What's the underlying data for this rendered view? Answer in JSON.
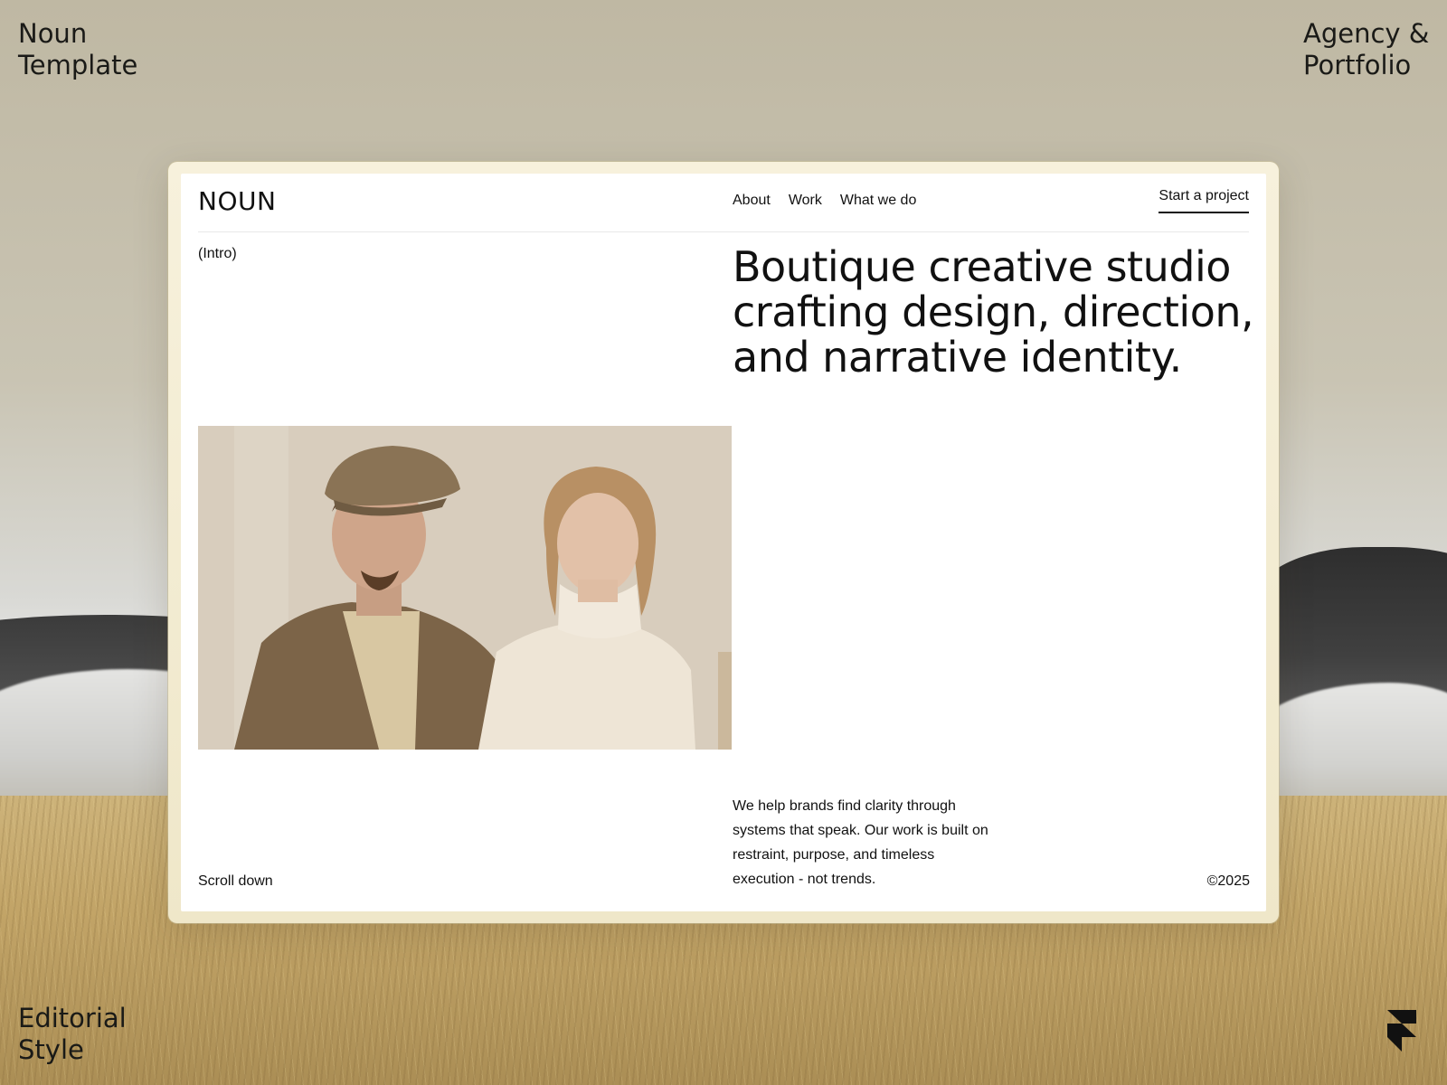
{
  "corners": {
    "top_left": [
      "Noun",
      "Template"
    ],
    "top_right": [
      "Agency &",
      "Portfolio"
    ],
    "bottom_left": [
      "Editorial",
      "Style"
    ]
  },
  "site": {
    "brand": "NOUN",
    "nav": [
      "About",
      "Work",
      "What we do"
    ],
    "cta": "Start a project",
    "intro_label": "(Intro)",
    "headline": "Boutique creative studio crafting design, direction, and narrative identity.",
    "description": "We help brands find clarity through systems that speak. Our work is built on restraint, purpose, and timeless execution - not trends.",
    "scroll_label": "Scroll down",
    "copyright": "©2025"
  },
  "icons": {
    "framer": "framer-logo-icon"
  },
  "colors": {
    "text": "#111111",
    "frame": "#f4eed6",
    "background": "#c5bfad"
  }
}
